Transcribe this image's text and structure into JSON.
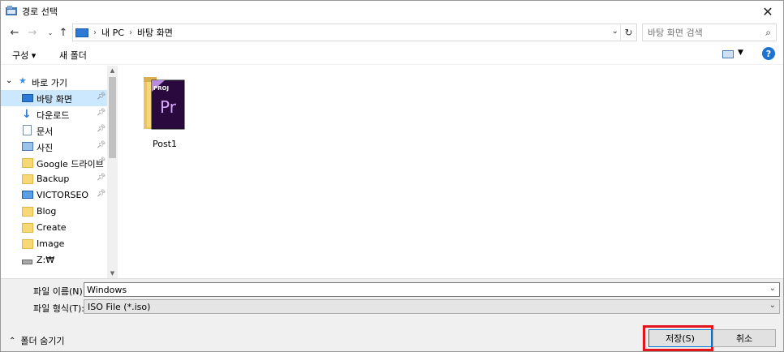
{
  "window": {
    "title": "경로 선택",
    "close_label": "✕"
  },
  "nav": {
    "breadcrumb": [
      "내 PC",
      "바탕 화면"
    ],
    "search_placeholder": "바탕 화면 검색"
  },
  "toolbar": {
    "organize_label": "구성 ▾",
    "new_folder_label": "새 폴더",
    "help_label": "?"
  },
  "sidebar": {
    "quick_access_label": "바로 가기",
    "items": [
      {
        "label": "바탕 화면",
        "icon": "desktop-icon",
        "pinned": true,
        "selected": true
      },
      {
        "label": "다운로드",
        "icon": "download-icon",
        "pinned": true
      },
      {
        "label": "문서",
        "icon": "document-icon",
        "pinned": true
      },
      {
        "label": "사진",
        "icon": "picture-icon",
        "pinned": true
      },
      {
        "label": "Google 드라이브",
        "icon": "folder-icon",
        "pinned": true
      },
      {
        "label": "Backup",
        "icon": "folder-icon",
        "pinned": true
      },
      {
        "label": "VICTORSEO",
        "icon": "monitor-icon",
        "pinned": true
      },
      {
        "label": "Blog",
        "icon": "folder-icon",
        "pinned": false
      },
      {
        "label": "Create",
        "icon": "folder-icon",
        "pinned": false
      },
      {
        "label": "Image",
        "icon": "folder-icon",
        "pinned": false
      },
      {
        "label": "Z:₩",
        "icon": "network-drive-icon",
        "pinned": false
      }
    ]
  },
  "files": [
    {
      "name": "Post1",
      "icon": "premiere-project-folder-icon",
      "badge": "PROJ",
      "logo": "Pr"
    }
  ],
  "form": {
    "filename_label": "파일 이름(N):",
    "filename_value": "Windows",
    "filetype_label": "파일 형식(T):",
    "filetype_value": "ISO File (*.iso)"
  },
  "footer": {
    "hide_folders_label": "폴더 숨기기",
    "save_label": "저장(S)",
    "cancel_label": "취소"
  },
  "colors": {
    "accent": "#0078d7",
    "highlight": "#e3141b",
    "selection": "#cce8ff",
    "premiere": "#2a0a3e"
  }
}
